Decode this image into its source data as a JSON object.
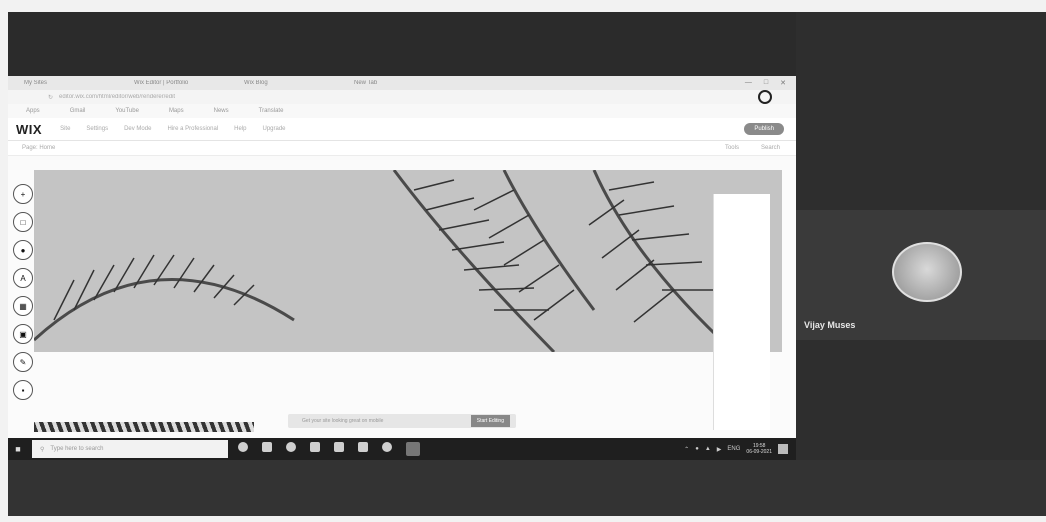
{
  "browser": {
    "tabs": [
      "My Sites",
      "Wix Editor | Portfolio",
      "Wix Blog",
      "New Tab"
    ],
    "url": "editor.wix.com/html/editor/web/renderer/edit",
    "bookmarks": [
      "Apps",
      "Gmail",
      "YouTube",
      "Maps",
      "News",
      "Translate"
    ]
  },
  "wix": {
    "logo": "WIX",
    "menu": [
      "Site",
      "Settings",
      "Dev Mode",
      "Hire a Professional",
      "Help",
      "Upgrade"
    ],
    "publish_label": "Publish",
    "page_label": "Page: Home",
    "tools": [
      "Tools",
      "Search"
    ]
  },
  "editor": {
    "left_tools": [
      "add-icon",
      "section-icon",
      "add-elements-icon",
      "design-icon",
      "apps-icon",
      "media-icon",
      "blog-icon",
      "business-icon"
    ],
    "preview_text": "Get your site looking great on mobile",
    "preview_button": "Start Editing"
  },
  "taskbar": {
    "search_placeholder": "Type here to search",
    "time": "19:58",
    "date": "06-09-2021",
    "lang": "ENG"
  },
  "meeting": {
    "participant_name": "Vijay Muses"
  }
}
